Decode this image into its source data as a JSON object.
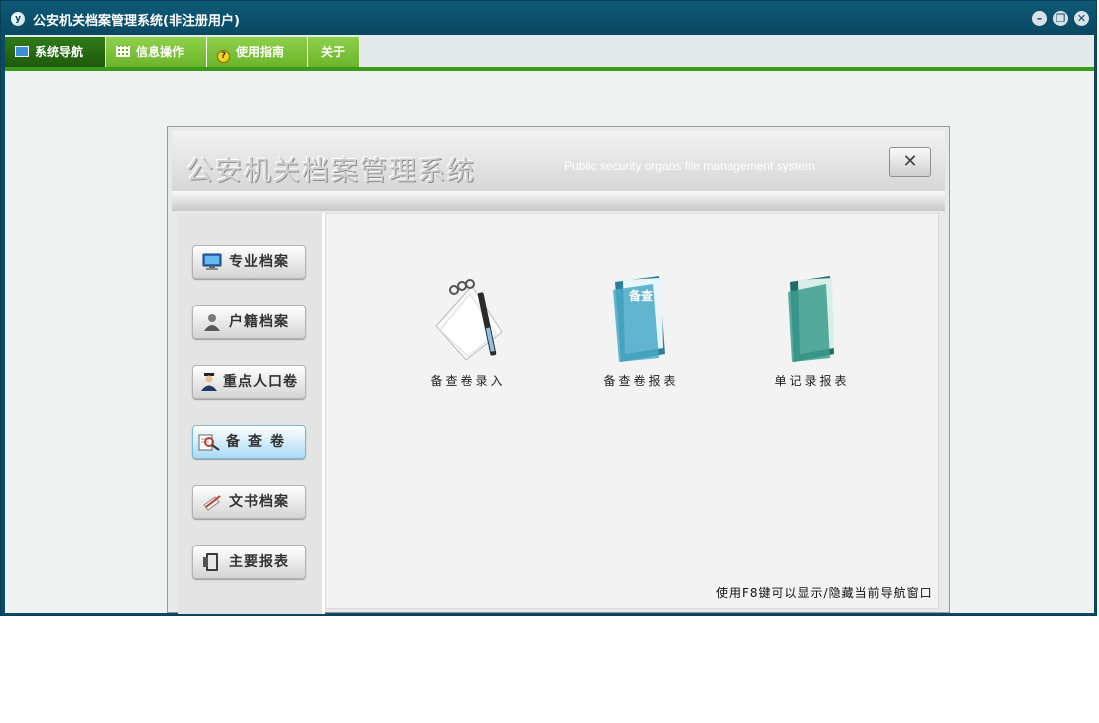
{
  "window": {
    "title": "公安机关档案管理系统(非注册用户)",
    "app_icon_glyph": "y",
    "controls": [
      "minimize-icon",
      "restore-icon",
      "close-icon"
    ]
  },
  "menu": [
    {
      "label": "系统导航",
      "icon": "monitor-icon",
      "active": true
    },
    {
      "label": "信息操作",
      "icon": "grid-icon",
      "active": false
    },
    {
      "label": "使用指南",
      "icon": "help-icon",
      "active": false
    },
    {
      "label": "关于",
      "icon": "",
      "active": false
    }
  ],
  "dialog": {
    "title": "公安机关档案管理系统",
    "subtitle": "Public security organs file management system",
    "close_glyph": "✕"
  },
  "sidebar": [
    {
      "label": "专业档案",
      "icon": "monitor-icon",
      "active": false
    },
    {
      "label": "户籍档案",
      "icon": "person-icon",
      "active": false
    },
    {
      "label": "重点人口卷",
      "icon": "officer-icon",
      "active": false
    },
    {
      "label": "备查卷",
      "icon": "magnifier-document-icon",
      "active": true
    },
    {
      "label": "文书档案",
      "icon": "pen-paper-icon",
      "active": false
    },
    {
      "label": "主要报表",
      "icon": "report-book-icon",
      "active": false
    }
  ],
  "tiles": [
    {
      "label": "备查卷录入",
      "icon": "notepad-pen-icon"
    },
    {
      "label": "备查卷报表",
      "icon": "folder-icon",
      "folder_text": "备查"
    },
    {
      "label": "单记录报表",
      "icon": "folder-icon"
    }
  ],
  "hint": "使用F8键可以显示/隐藏当前导航窗口",
  "colors": {
    "titlebar": "#0b4a63",
    "menu_green": "#6bb52a",
    "menu_active": "#1e5a0c",
    "accent_blue": "#a9daf4"
  }
}
